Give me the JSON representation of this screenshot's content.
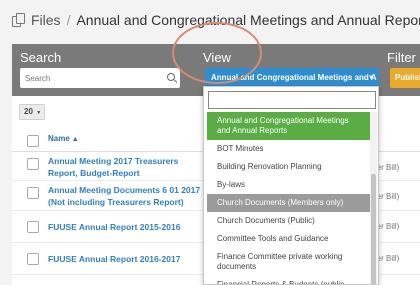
{
  "breadcrumb": {
    "root": "Files",
    "separator": "/",
    "current": "Annual and Congregational Meetings and Annual Reports"
  },
  "filterbar": {
    "search_label": "Search",
    "search_placeholder": "Search",
    "view_label": "View",
    "view_selected": "Annual and Congregational Meetings and A",
    "filter_label": "Filter",
    "filter_button": "Publish"
  },
  "table": {
    "page_size": "20",
    "name_header": "Name",
    "rows": [
      {
        "name": "Annual Meeting 2017 Treasurers Report, Budget-Report",
        "owner": "aster Bill)"
      },
      {
        "name": "Annual Meeting Documents 6 01 2017 (Not including Treasurers Report)",
        "owner": "aster Bill)"
      },
      {
        "name": "FUUSE Annual Report 2015-2016",
        "owner": "aster Bill)"
      },
      {
        "name": "FUUSE Annual Report 2016-2017",
        "owner": "aster Bill)"
      }
    ]
  },
  "dropdown": {
    "search_value": "",
    "items": [
      {
        "label": "Annual and Congregational Meetings and Annual Reports",
        "state": "selected"
      },
      {
        "label": "BOT Minutes",
        "state": ""
      },
      {
        "label": "Building Renovation Planning",
        "state": ""
      },
      {
        "label": "By-laws",
        "state": ""
      },
      {
        "label": "Church Documents (Members only)",
        "state": "hover"
      },
      {
        "label": "Church Documents (Public)",
        "state": ""
      },
      {
        "label": "Committee Tools and Guidance",
        "state": ""
      },
      {
        "label": "Finance Committee private working documents",
        "state": ""
      },
      {
        "label": "Financial Reports & Budgets (public",
        "state": ""
      }
    ]
  },
  "colors": {
    "filterbar_bg": "#7a7a7a",
    "view_select": "#2f8dd0",
    "publish_button": "#e9a92a",
    "selected_item": "#5aac44",
    "hover_item": "#9b9b9b",
    "link": "#2f7fc1",
    "annotation_circle": "#d98b72"
  },
  "icons": [
    "files-icon",
    "search-icon",
    "chevron-down-icon",
    "sort-up-icon"
  ]
}
